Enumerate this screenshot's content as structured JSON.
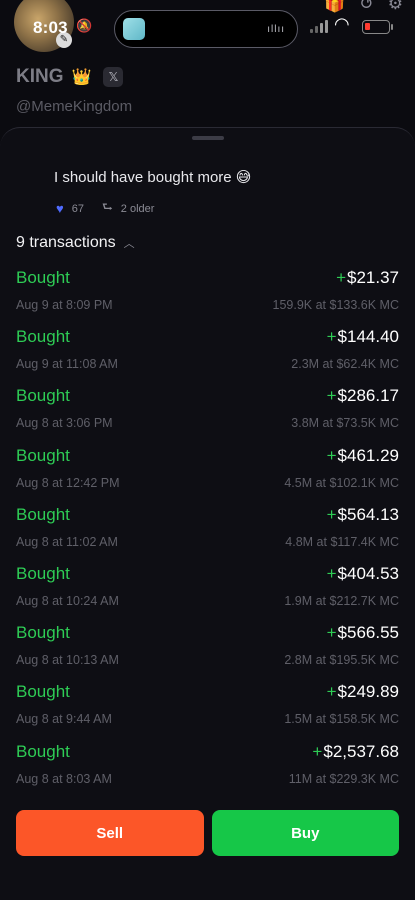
{
  "status_bar": {
    "time": "8:03",
    "colors": {
      "battery_low": "#ff3b30"
    }
  },
  "header": {
    "title": "KING",
    "title_emoji": "👑",
    "x_badge": "𝕏",
    "handle": "@MemeKingdom"
  },
  "comment": {
    "text": "I should have bought more 😅",
    "likes": "67",
    "older": "2 older"
  },
  "transactions": {
    "count_label": "9 transactions",
    "items": [
      {
        "type": "Bought",
        "date": "Aug 9 at 8:09 PM",
        "amount": "$21.37",
        "detail": "159.9K at $133.6K MC"
      },
      {
        "type": "Bought",
        "date": "Aug 9 at 11:08 AM",
        "amount": "$144.40",
        "detail": "2.3M at $62.4K MC"
      },
      {
        "type": "Bought",
        "date": "Aug 8 at 3:06 PM",
        "amount": "$286.17",
        "detail": "3.8M at $73.5K MC"
      },
      {
        "type": "Bought",
        "date": "Aug 8 at 12:42 PM",
        "amount": "$461.29",
        "detail": "4.5M at $102.1K MC"
      },
      {
        "type": "Bought",
        "date": "Aug 8 at 11:02 AM",
        "amount": "$564.13",
        "detail": "4.8M at $117.4K MC"
      },
      {
        "type": "Bought",
        "date": "Aug 8 at 10:24 AM",
        "amount": "$404.53",
        "detail": "1.9M at $212.7K MC"
      },
      {
        "type": "Bought",
        "date": "Aug 8 at 10:13 AM",
        "amount": "$566.55",
        "detail": "2.8M at $195.5K MC"
      },
      {
        "type": "Bought",
        "date": "Aug 8 at 9:44 AM",
        "amount": "$249.89",
        "detail": "1.5M at $158.5K MC"
      },
      {
        "type": "Bought",
        "date": "Aug 8 at 8:03 AM",
        "amount": "$2,537.68",
        "detail": "11M at $229.3K MC"
      }
    ]
  },
  "actions": {
    "sell_label": "Sell",
    "buy_label": "Buy"
  },
  "colors": {
    "buy_green": "#16c748",
    "sell_orange": "#fc5628",
    "bought_text": "#2ecc55",
    "like_heart": "#4f6bff"
  }
}
